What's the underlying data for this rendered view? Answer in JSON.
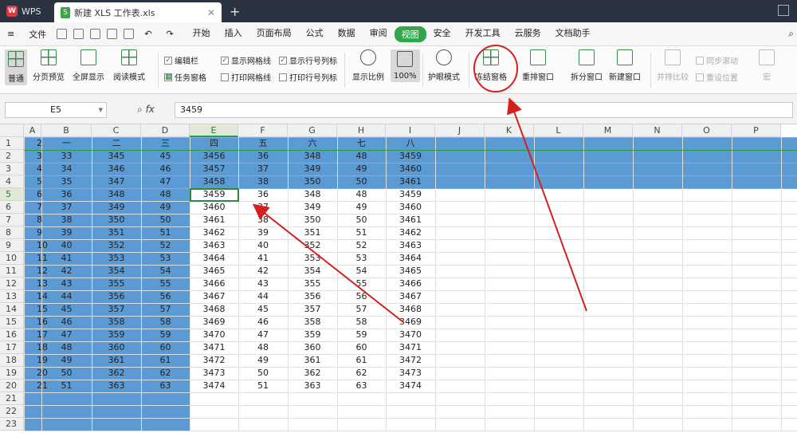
{
  "tabs": {
    "app": "WPS",
    "file": "新建 XLS 工作表.xls"
  },
  "menu": {
    "file": "文件",
    "items": [
      "开始",
      "插入",
      "页面布局",
      "公式",
      "数据",
      "审阅",
      "视图",
      "安全",
      "开发工具",
      "云服务",
      "文档助手"
    ],
    "active": "视图",
    "search_icon": "search-icon"
  },
  "ribbon": {
    "normal": "普通",
    "pagebreak": "分页预览",
    "fullscreen": "全屏显示",
    "readmode": "阅读模式",
    "cb_editbar": "编辑栏",
    "cb_taskpane": "任务窗格",
    "cb_gridlines": "显示网格线",
    "cb_printgrid": "打印网格线",
    "cb_rowcol": "显示行号列标",
    "cb_printrowcol": "打印行号列标",
    "zoom": "显示比例",
    "zoom100": "100%",
    "eyecare": "护眼模式",
    "freeze": "冻结窗格",
    "arrange": "重排窗口",
    "split": "拆分窗口",
    "newwin": "新建窗口",
    "sidebyside": "并排比较",
    "syncscroll": "同步滚动",
    "resetpos": "重设位置",
    "macro": "宏"
  },
  "formula": {
    "cellref": "E5",
    "fx": "fx",
    "value": "3459"
  },
  "columns": [
    "A",
    "B",
    "C",
    "D",
    "E",
    "F",
    "G",
    "H",
    "I",
    "J",
    "K",
    "L",
    "M",
    "N",
    "O",
    "P"
  ],
  "rows": [
    [
      "2",
      "一",
      "二",
      "三",
      "四",
      "五",
      "六",
      "七",
      "八"
    ],
    [
      "3",
      "33",
      "345",
      "45",
      "3456",
      "36",
      "348",
      "48",
      "3459"
    ],
    [
      "4",
      "34",
      "346",
      "46",
      "3457",
      "37",
      "349",
      "49",
      "3460"
    ],
    [
      "5",
      "35",
      "347",
      "47",
      "3458",
      "38",
      "350",
      "50",
      "3461"
    ],
    [
      "6",
      "36",
      "348",
      "48",
      "3459",
      "36",
      "348",
      "48",
      "3459"
    ],
    [
      "7",
      "37",
      "349",
      "49",
      "3460",
      "37",
      "349",
      "49",
      "3460"
    ],
    [
      "8",
      "38",
      "350",
      "50",
      "3461",
      "38",
      "350",
      "50",
      "3461"
    ],
    [
      "9",
      "39",
      "351",
      "51",
      "3462",
      "39",
      "351",
      "51",
      "3462"
    ],
    [
      "10",
      "40",
      "352",
      "52",
      "3463",
      "40",
      "352",
      "52",
      "3463"
    ],
    [
      "11",
      "41",
      "353",
      "53",
      "3464",
      "41",
      "353",
      "53",
      "3464"
    ],
    [
      "12",
      "42",
      "354",
      "54",
      "3465",
      "42",
      "354",
      "54",
      "3465"
    ],
    [
      "13",
      "43",
      "355",
      "55",
      "3466",
      "43",
      "355",
      "55",
      "3466"
    ],
    [
      "14",
      "44",
      "356",
      "56",
      "3467",
      "44",
      "356",
      "56",
      "3467"
    ],
    [
      "15",
      "45",
      "357",
      "57",
      "3468",
      "45",
      "357",
      "57",
      "3468"
    ],
    [
      "16",
      "46",
      "358",
      "58",
      "3469",
      "46",
      "358",
      "58",
      "3469"
    ],
    [
      "17",
      "47",
      "359",
      "59",
      "3470",
      "47",
      "359",
      "59",
      "3470"
    ],
    [
      "18",
      "48",
      "360",
      "60",
      "3471",
      "48",
      "360",
      "60",
      "3471"
    ],
    [
      "19",
      "49",
      "361",
      "61",
      "3472",
      "49",
      "361",
      "61",
      "3472"
    ],
    [
      "20",
      "50",
      "362",
      "62",
      "3473",
      "50",
      "362",
      "62",
      "3473"
    ],
    [
      "21",
      "51",
      "363",
      "63",
      "3474",
      "51",
      "363",
      "63",
      "3474"
    ]
  ],
  "row_count": 23,
  "selected_cell": "E5",
  "colors": {
    "selection_blue": "#5b9bd5",
    "accent_green": "#2fa74a",
    "annotation_red": "#d42020"
  }
}
